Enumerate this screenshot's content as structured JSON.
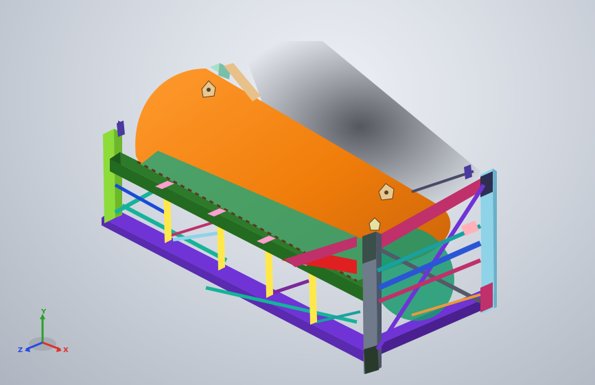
{
  "viewport": {
    "background_top": "#eef1f6",
    "background_bottom": "#aeb5c0"
  },
  "triad": {
    "x_label": "X",
    "y_label": "Y",
    "z_label": "Z",
    "x_color": "#e0302a",
    "y_color": "#2aa02a",
    "z_color": "#2a4ae0"
  },
  "model": {
    "drum_color": "#f07d0a",
    "frame_colors": [
      "#6f33d6",
      "#8edc3a",
      "#ffe84c",
      "#16b39a",
      "#2a56d6",
      "#c0306a",
      "#7a2a9a",
      "#1aa0a0",
      "#ff7fb0"
    ]
  }
}
